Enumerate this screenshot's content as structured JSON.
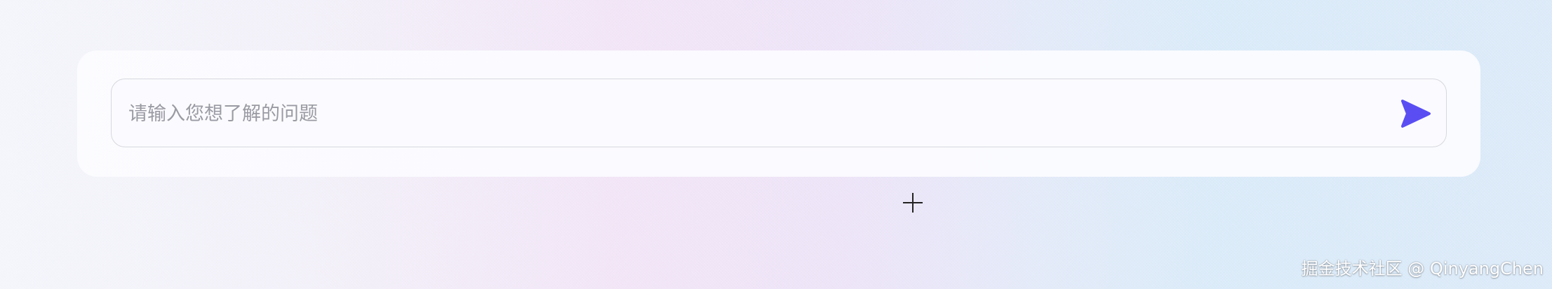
{
  "chat_input": {
    "placeholder": "请输入您想了解的问题",
    "value": ""
  },
  "send_button": {
    "icon": "send-icon",
    "color": "#5a4ef3"
  },
  "cursor": {
    "icon": "crosshair-cursor-icon"
  },
  "watermark": {
    "text": "掘金技术社区 @ QinyangChen"
  }
}
